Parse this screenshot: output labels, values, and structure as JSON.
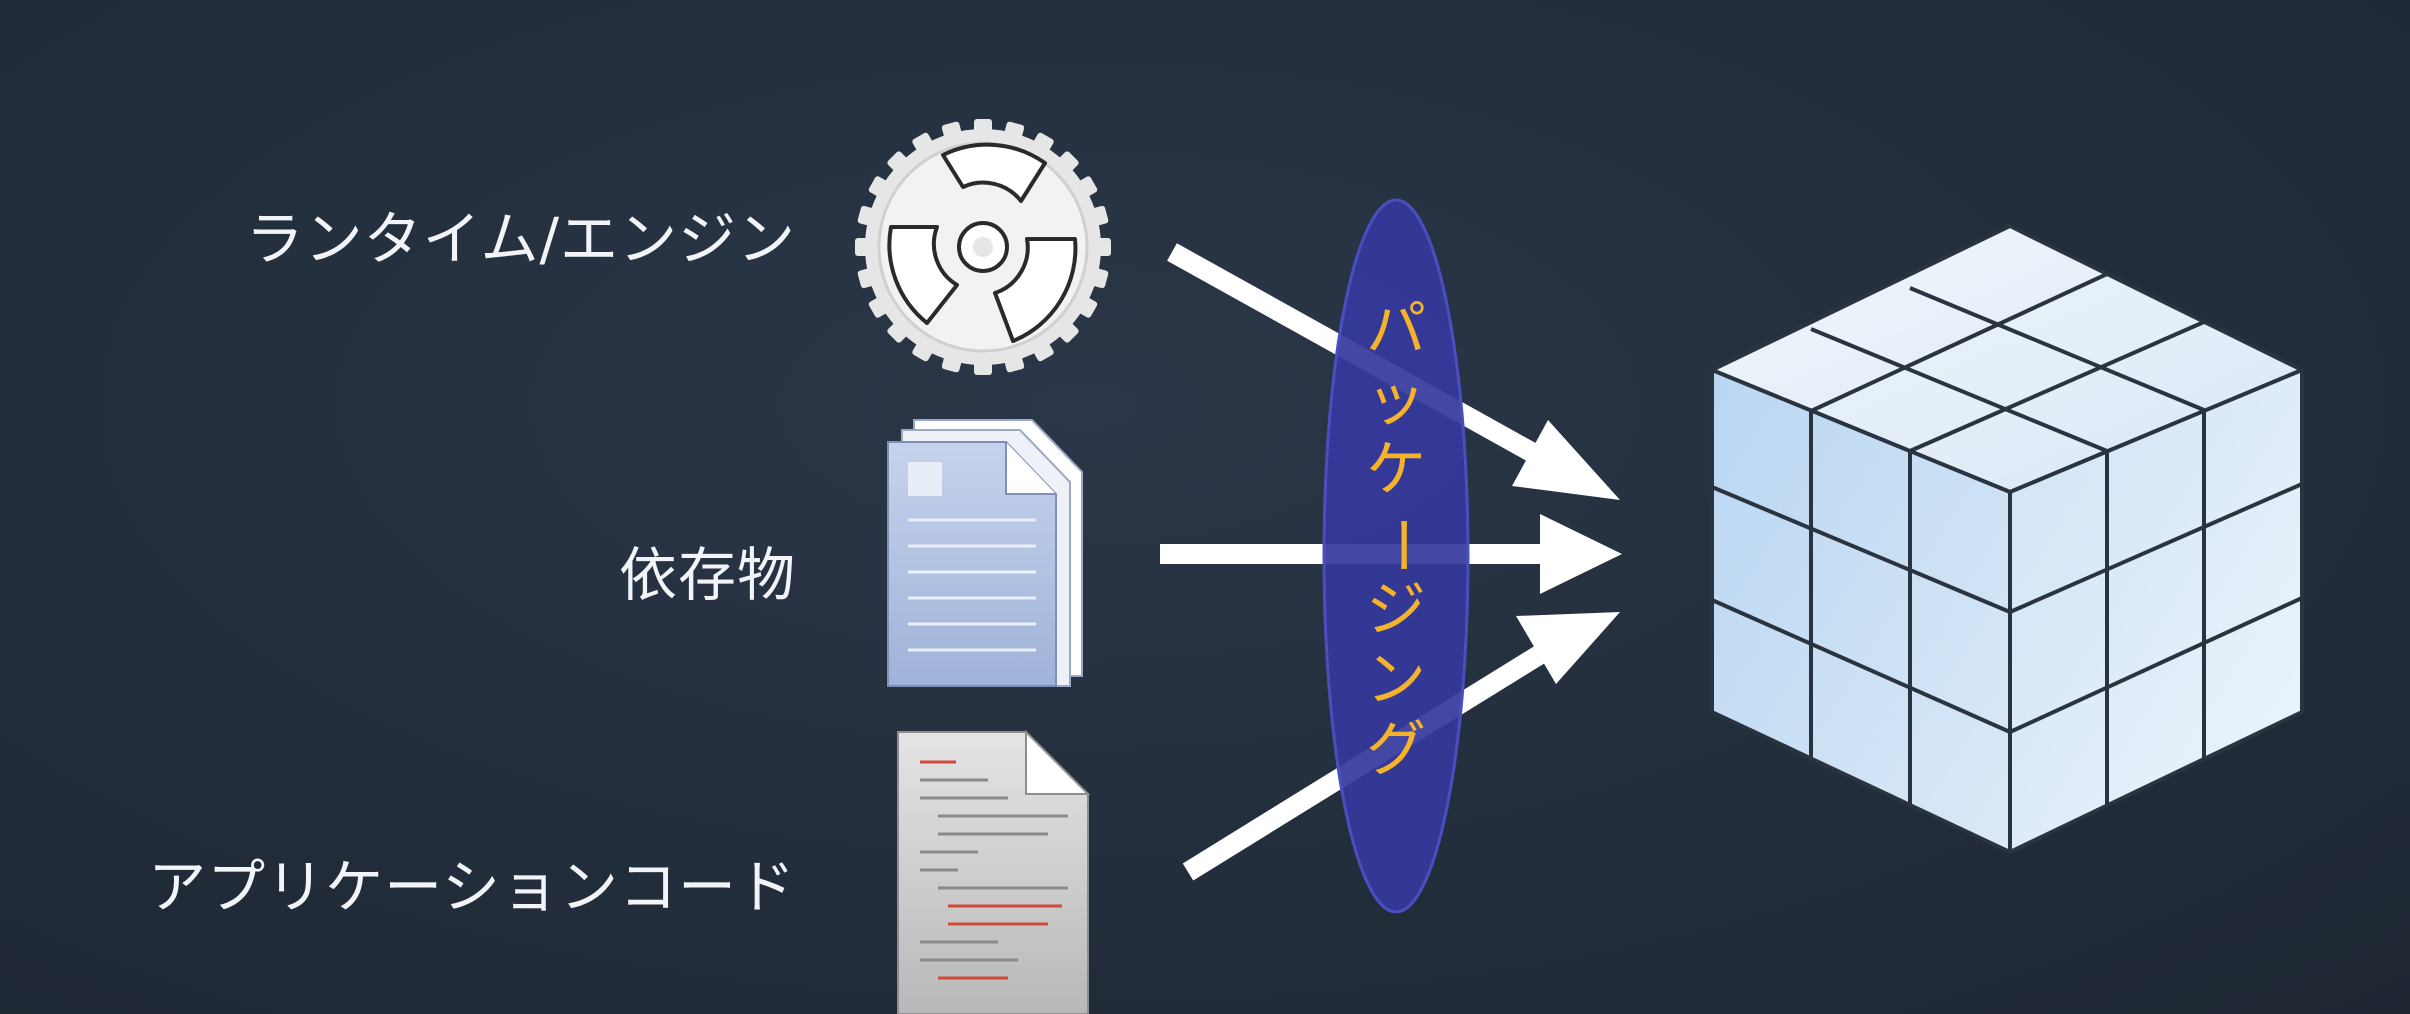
{
  "inputs": {
    "runtime_label": "ランタイム/エンジン",
    "dependencies_label": "依存物",
    "app_code_label": "アプリケーションコード"
  },
  "process": {
    "label_chars": [
      "パ",
      "ッ",
      "ケ",
      "ー",
      "ジ",
      "ン",
      "グ"
    ]
  },
  "icons": {
    "runtime": "gear-icon",
    "dependencies": "document-stack-icon",
    "app_code": "code-file-icon",
    "output": "container-cube-icon"
  },
  "colors": {
    "background": "#24303f",
    "text": "#f2f4f7",
    "lens": "#363a9c",
    "packaging_text": "#f5b32a",
    "arrow": "#ffffff",
    "cube": "#cfe2f5"
  }
}
